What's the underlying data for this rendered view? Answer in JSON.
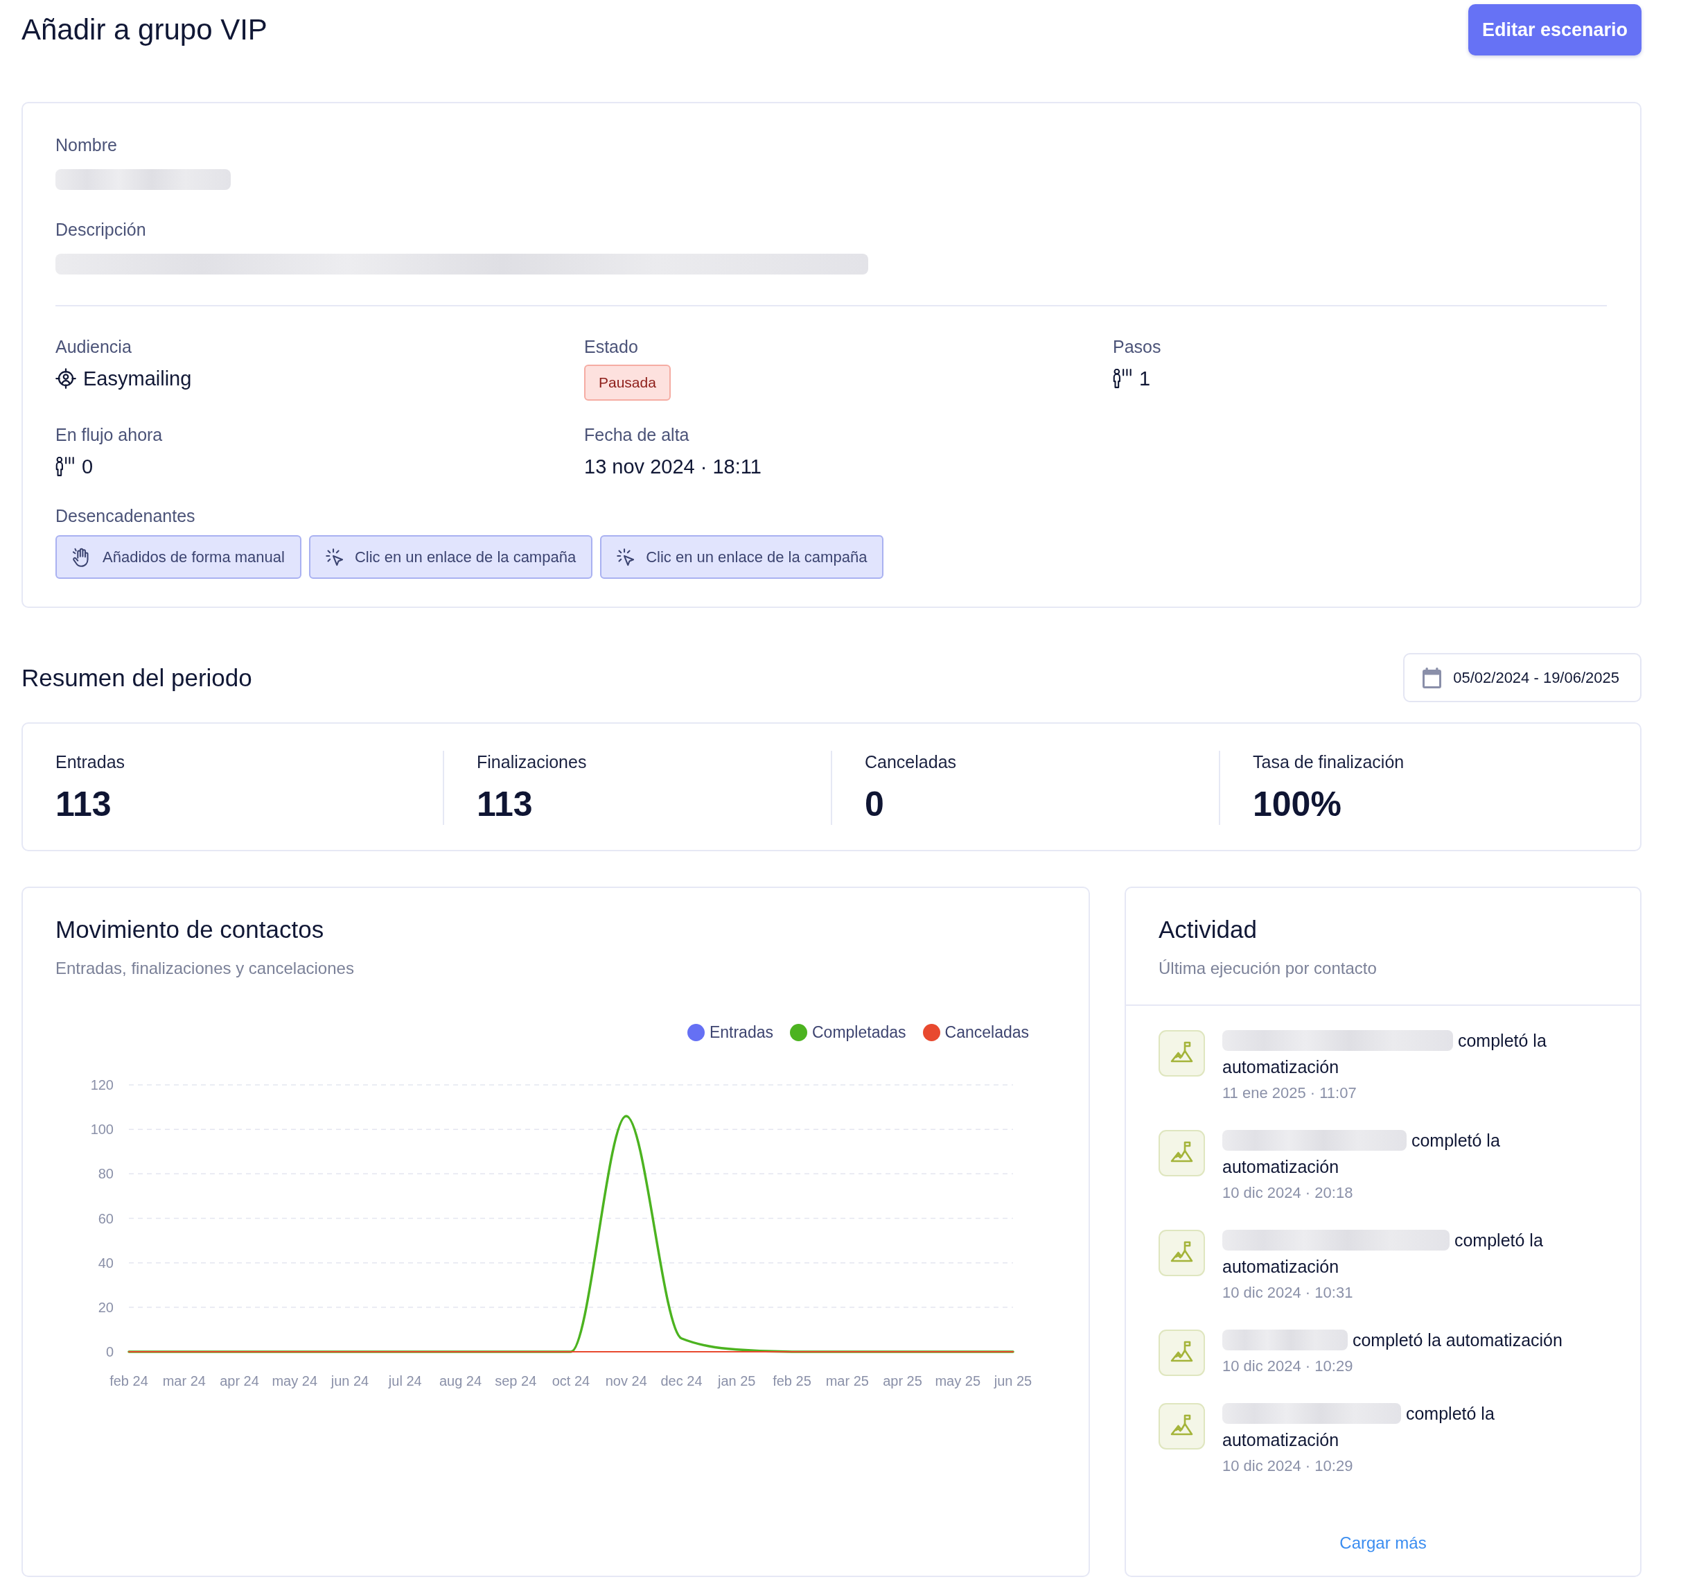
{
  "header": {
    "title": "Añadir a grupo VIP",
    "edit_button": "Editar escenario"
  },
  "details": {
    "fields": [
      {
        "label": "Nombre",
        "redacted": true
      },
      {
        "label": "Descripción",
        "redacted": true
      }
    ],
    "properties": [
      {
        "kind": "audience",
        "label": "Audiencia",
        "value": "Easymailing"
      },
      {
        "kind": "status",
        "label": "Estado",
        "value": "Pausada"
      },
      {
        "kind": "count",
        "label": "Pasos",
        "value": "1"
      },
      {
        "kind": "count",
        "label": "En flujo ahora",
        "value": "0"
      },
      {
        "kind": "date",
        "label": "Fecha de alta",
        "value": "13 nov 2024 · 18:11"
      }
    ],
    "triggers": {
      "label": "Desencadenantes",
      "items": [
        {
          "kind": "manual",
          "label": "Añadidos de forma manual"
        },
        {
          "kind": "link_click",
          "label": "Clic en un enlace de la campaña"
        },
        {
          "kind": "link_click",
          "label": "Clic en un enlace de la campaña"
        }
      ]
    }
  },
  "summary": {
    "title": "Resumen del periodo",
    "date_range": "05/02/2024 - 19/06/2025",
    "stats": [
      {
        "label": "Entradas",
        "value": "113"
      },
      {
        "label": "Finalizaciones",
        "value": "113"
      },
      {
        "label": "Canceladas",
        "value": "0"
      },
      {
        "label": "Tasa de finalización",
        "value": "100%"
      }
    ]
  },
  "movement": {
    "title": "Movimiento de contactos",
    "subtitle": "Entradas, finalizaciones y cancelaciones",
    "chart_data": {
      "type": "line",
      "legend": "top-right",
      "grid": true,
      "categories": [
        "feb 24",
        "mar 24",
        "apr 24",
        "may 24",
        "jun 24",
        "jul 24",
        "aug 24",
        "sep 24",
        "oct 24",
        "nov 24",
        "dec 24",
        "jan 25",
        "feb 25",
        "mar 25",
        "apr 25",
        "may 25",
        "jun 25"
      ],
      "series": [
        {
          "name": "Entradas",
          "color": "#6570f4",
          "values": [
            null,
            null,
            null,
            null,
            null,
            null,
            null,
            null,
            null,
            null,
            null,
            null,
            null,
            null,
            null,
            null,
            null
          ]
        },
        {
          "name": "Completadas",
          "color": "#4cb320",
          "values": [
            0,
            0,
            0,
            0,
            0,
            0,
            0,
            0,
            0,
            106,
            6,
            1,
            0,
            0,
            0,
            0,
            0
          ]
        },
        {
          "name": "Canceladas",
          "color": "#e8492f",
          "values": [
            0,
            0,
            0,
            0,
            0,
            0,
            0,
            0,
            0,
            0,
            0,
            0,
            0,
            0,
            0,
            0,
            0
          ]
        }
      ],
      "ylim": [
        0,
        120
      ],
      "yticks": [
        0,
        20,
        40,
        60,
        80,
        100,
        120
      ]
    }
  },
  "activity": {
    "title": "Actividad",
    "subtitle": "Última ejecución por contacto",
    "items": [
      {
        "contact_redacted": true,
        "text": "completó la automatización",
        "time": "11 ene 2025 · 11:07"
      },
      {
        "contact_redacted": true,
        "text": "completó la automatización",
        "time": "10 dic 2024 · 20:18"
      },
      {
        "contact_redacted": true,
        "text": "completó la automatización",
        "time": "10 dic 2024 · 10:31"
      },
      {
        "contact_redacted": true,
        "text": "completó la automatización",
        "time": "10 dic 2024 · 10:29"
      },
      {
        "contact_redacted": true,
        "text": "completó la automatización",
        "time": "10 dic 2024 · 10:29"
      }
    ],
    "load_more": "Cargar más"
  }
}
